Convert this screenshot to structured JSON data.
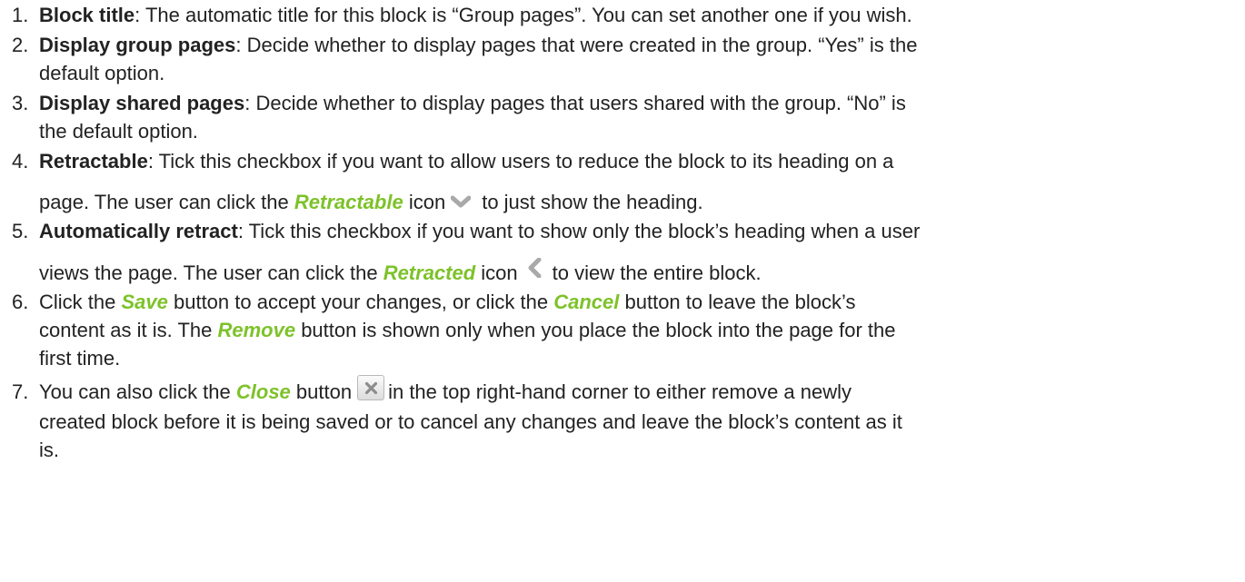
{
  "items": [
    {
      "num": "1.",
      "term": "Block title",
      "text": ": The automatic title for this block is “Group pages”. You can set another one if you wish."
    },
    {
      "num": "2.",
      "term": "Display group pages",
      "text_1": ": Decide whether to display pages that were created in the group. “Yes” is the",
      "text_2": "default option."
    },
    {
      "num": "3.",
      "term": "Display shared pages",
      "text_1": ": Decide whether to display pages that users shared with the group. “No” is",
      "text_2": "the default option."
    },
    {
      "num": "4.",
      "term": "Retractable",
      "text_1": ": Tick this checkbox if you want to allow users to reduce the block to its heading on a",
      "text_2a": "page. The user can click the ",
      "ui_name": "Retractable",
      "text_2b": " icon",
      "text_2c": "to just show the heading.",
      "icon": "chevron-down-icon"
    },
    {
      "num": "5.",
      "term": "Automatically retract",
      "text_1": ": Tick this checkbox if you want to show only the block’s heading when a user",
      "text_2a": "views the page. The user can click the ",
      "ui_name": "Retracted",
      "text_2b": " icon",
      "text_2c": "to view the entire block.",
      "icon": "chevron-left-icon"
    },
    {
      "num": "6.",
      "text_1a": "Click the ",
      "save": "Save",
      "text_1b": " button to accept your changes, or click the ",
      "cancel": "Cancel",
      "text_1c": " button to leave the block’s",
      "text_2a": "content as it is. The ",
      "remove": "Remove",
      "text_2b": " button is shown only when you place the block into the page for the",
      "text_3": "first time."
    },
    {
      "num": "7.",
      "text_1a": "You can also click the ",
      "close": "Close",
      "text_1b": " button",
      "text_1c": "in the top right-hand corner to either remove a newly",
      "text_2": "created block before it is being saved or to cancel any changes and leave the block’s content as it",
      "text_3": "is.",
      "icon": "close-icon"
    }
  ],
  "colors": {
    "text": "#222222",
    "ui_name": "#7dc229",
    "icon_gray": "#a9a9a9"
  }
}
